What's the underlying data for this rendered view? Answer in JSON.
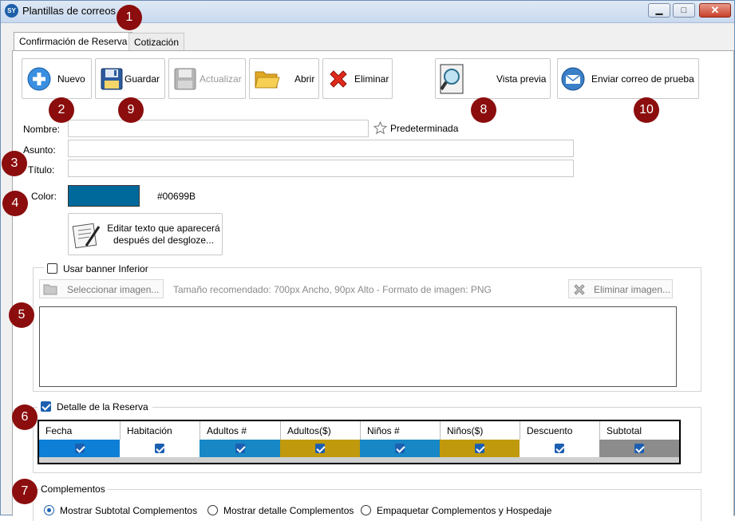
{
  "window": {
    "title": "Plantillas de correos",
    "icon_text": "SY"
  },
  "tabs": [
    {
      "label": "Confirmación de Reserva",
      "active": true
    },
    {
      "label": "Cotización",
      "active": false
    }
  ],
  "toolbar": {
    "nuevo": "Nuevo",
    "guardar": "Guardar",
    "actualizar": "Actualizar",
    "abrir": "Abrir",
    "eliminar": "Eliminar",
    "vista_previa": "Vista previa",
    "enviar_prueba": "Enviar correo de prueba"
  },
  "form": {
    "nombre_label": "Nombre:",
    "nombre_value": "",
    "predeterminada_label": "Predeterminada",
    "asunto_label": "Asunto:",
    "asunto_value": "",
    "titulo_label": "Título:",
    "titulo_value": "",
    "color_label": "Color:",
    "color_hex": "#00699B",
    "edit_text_button": "Editar texto que aparecerá después del desgloze..."
  },
  "banner": {
    "checkbox_label": "Usar banner Inferior",
    "checked": false,
    "select_image": "Seleccionar imagen...",
    "hint": "Tamaño recomendado: 700px Ancho, 90px Alto - Formato de imagen: PNG",
    "delete_image": "Eliminar imagen..."
  },
  "detalle": {
    "checkbox_label": "Detalle de la Reserva",
    "checked": true,
    "columns": [
      {
        "header": "Fecha",
        "color": "#0d7fd6",
        "checked": true
      },
      {
        "header": "Habitación",
        "color": "#ffffff",
        "checked": true
      },
      {
        "header": "Adultos #",
        "color": "#1787c6",
        "checked": true
      },
      {
        "header": "Adultos($)",
        "color": "#c09a0c",
        "checked": true
      },
      {
        "header": "Niños #",
        "color": "#1787c6",
        "checked": true
      },
      {
        "header": "Niños($)",
        "color": "#c09a0c",
        "checked": true
      },
      {
        "header": "Descuento",
        "color": "#ffffff",
        "checked": true
      },
      {
        "header": "Subtotal",
        "color": "#8c8c8c",
        "checked": true
      }
    ]
  },
  "complementos": {
    "label": "Complementos",
    "options": [
      {
        "label": "Mostrar Subtotal Complementos",
        "selected": true
      },
      {
        "label": "Mostrar detalle Complementos",
        "selected": false
      },
      {
        "label": "Empaquetar Complementos y Hospedaje",
        "selected": false
      }
    ]
  },
  "badges": [
    "1",
    "2",
    "3",
    "4",
    "5",
    "6",
    "7",
    "8",
    "9",
    "10"
  ],
  "colors": {
    "accent": "#1c5fb1",
    "badge": "#8b0d0d",
    "swatch": "#00699B"
  }
}
